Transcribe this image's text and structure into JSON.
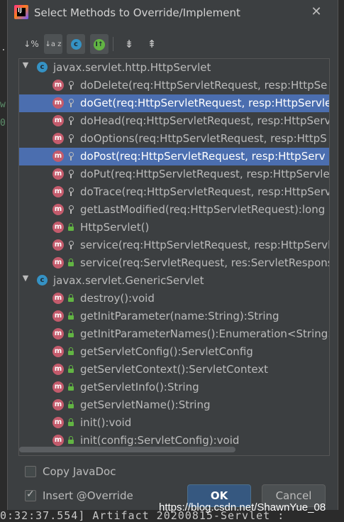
{
  "dialog": {
    "title": "Select Methods to Override/Implement",
    "close_glyph": "✕"
  },
  "toolbar": {
    "buttons": [
      {
        "name": "sort-alpha-icon",
        "glyph": "↓%"
      },
      {
        "name": "sort-az-icon",
        "glyph": "↓a z"
      },
      {
        "name": "show-classes-icon",
        "glyph": "c"
      },
      {
        "name": "show-interfaces-icon",
        "glyph": "I↑"
      },
      {
        "name": "expand-all-icon",
        "glyph": "⇟"
      },
      {
        "name": "collapse-all-icon",
        "glyph": "⇞"
      }
    ]
  },
  "tree": {
    "groups": [
      {
        "class_name": "javax.servlet.http.HttpServlet",
        "methods": [
          {
            "label": "doDelete(req:HttpServletRequest, resp:HttpSe",
            "visibility": "protected",
            "selected": false
          },
          {
            "label": "doGet(req:HttpServletRequest, resp:HttpServle",
            "visibility": "protected",
            "selected": true
          },
          {
            "label": "doHead(req:HttpServletRequest, resp:HttpServ",
            "visibility": "protected",
            "selected": false
          },
          {
            "label": "doOptions(req:HttpServletRequest, resp:HttpS",
            "visibility": "protected",
            "selected": false
          },
          {
            "label": "doPost(req:HttpServletRequest, resp:HttpServ",
            "visibility": "protected",
            "selected": true
          },
          {
            "label": "doPut(req:HttpServletRequest, resp:HttpServle",
            "visibility": "protected",
            "selected": false
          },
          {
            "label": "doTrace(req:HttpServletRequest, resp:HttpServ",
            "visibility": "protected",
            "selected": false
          },
          {
            "label": "getLastModified(req:HttpServletRequest):long",
            "visibility": "protected",
            "selected": false
          },
          {
            "label": "HttpServlet()",
            "visibility": "public",
            "selected": false
          },
          {
            "label": "service(req:HttpServletRequest, resp:HttpServl",
            "visibility": "protected",
            "selected": false
          },
          {
            "label": "service(req:ServletRequest, res:ServletResponse):v",
            "visibility": "public",
            "selected": false
          }
        ]
      },
      {
        "class_name": "javax.servlet.GenericServlet",
        "methods": [
          {
            "label": "destroy():void",
            "visibility": "public",
            "selected": false
          },
          {
            "label": "getInitParameter(name:String):String",
            "visibility": "public",
            "selected": false
          },
          {
            "label": "getInitParameterNames():Enumeration<String>",
            "visibility": "public",
            "selected": false
          },
          {
            "label": "getServletConfig():ServletConfig",
            "visibility": "public",
            "selected": false
          },
          {
            "label": "getServletContext():ServletContext",
            "visibility": "public",
            "selected": false
          },
          {
            "label": "getServletInfo():String",
            "visibility": "public",
            "selected": false
          },
          {
            "label": "getServletName():String",
            "visibility": "public",
            "selected": false
          },
          {
            "label": "init():void",
            "visibility": "public",
            "selected": false
          },
          {
            "label": "init(config:ServletConfig):void",
            "visibility": "public",
            "selected": false
          }
        ]
      }
    ]
  },
  "options": {
    "copy_javadoc": {
      "label": "Copy JavaDoc",
      "checked": false
    },
    "insert_override": {
      "label": "Insert @Override",
      "checked": true
    }
  },
  "buttons": {
    "ok": "OK",
    "cancel": "Cancel"
  },
  "watermark": "https://blog.csdn.net/ShawnYue_08",
  "background": {
    "console_line": "0:32:37.554] Artifact 20200815-Servlet :"
  }
}
